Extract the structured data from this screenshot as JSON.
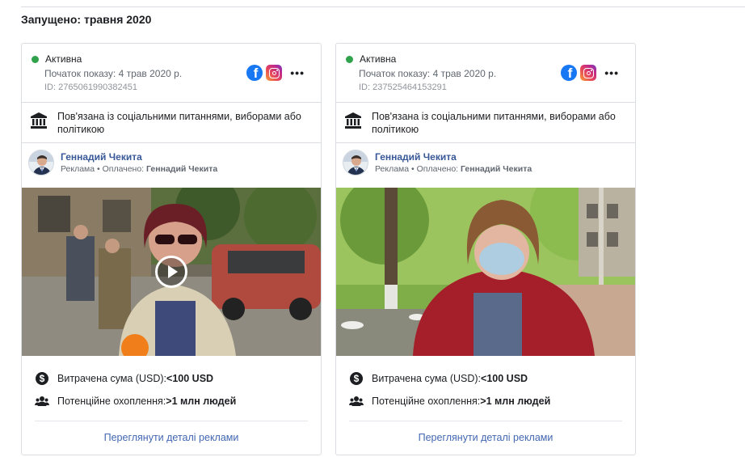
{
  "section_title": "Запущено: травня 2020",
  "colors": {
    "active_dot": "#31a24c",
    "link": "#4267b2",
    "advertiser": "#385898"
  },
  "cards": [
    {
      "status": "Активна",
      "start_date": "Початок показу: 4 трав 2020 р.",
      "library_id": "ID: 2765061990382451",
      "platforms": [
        "facebook-icon",
        "instagram-icon"
      ],
      "political_label": "Пов'язана із соціальними питаннями, виборами або політикою",
      "advertiser_name": "Геннадий Чекита",
      "sponsor_prefix": "Реклама • Оплачено: ",
      "sponsor_name": "Геннадий Чекита",
      "media_type": "video",
      "spend_label": "Витрачена сума (USD): ",
      "spend_value": "<100 USD",
      "reach_label": "Потенційне охоплення: ",
      "reach_value": ">1 млн людей",
      "details_link": "Переглянути деталі реклами"
    },
    {
      "status": "Активна",
      "start_date": "Початок показу: 4 трав 2020 р.",
      "library_id": "ID: 237525464153291",
      "platforms": [
        "facebook-icon",
        "instagram-icon"
      ],
      "political_label": "Пов'язана із соціальними питаннями, виборами або політикою",
      "advertiser_name": "Геннадий Чекита",
      "sponsor_prefix": "Реклама • Оплачено: ",
      "sponsor_name": "Геннадий Чекита",
      "media_type": "image",
      "spend_label": "Витрачена сума (USD): ",
      "spend_value": "<100 USD",
      "reach_label": "Потенційне охоплення: ",
      "reach_value": ">1 млн людей",
      "details_link": "Переглянути деталі реклами"
    }
  ]
}
